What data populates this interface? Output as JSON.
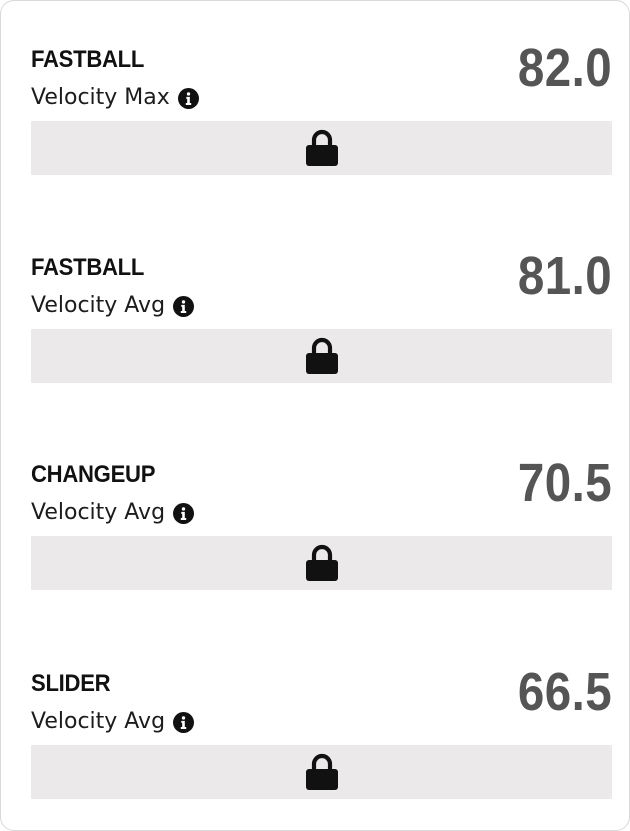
{
  "metrics": [
    {
      "pitch": "FASTBALL",
      "metric": "Velocity Max",
      "value": "82.0",
      "locked": true
    },
    {
      "pitch": "FASTBALL",
      "metric": "Velocity Avg",
      "value": "81.0",
      "locked": true
    },
    {
      "pitch": "CHANGEUP",
      "metric": "Velocity Avg",
      "value": "70.5",
      "locked": true
    },
    {
      "pitch": "SLIDER",
      "metric": "Velocity Avg",
      "value": "66.5",
      "locked": true
    }
  ],
  "icons": {
    "info": "info-icon",
    "lock": "lock-icon"
  },
  "colors": {
    "value_text": "#555555",
    "locked_bar": "#ebe9e9",
    "icon": "#111111"
  }
}
